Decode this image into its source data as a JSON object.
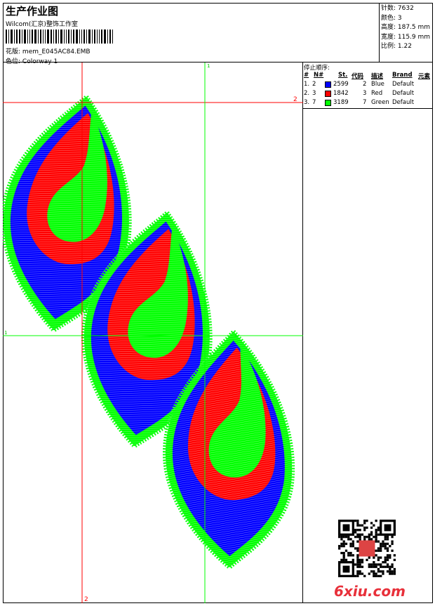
{
  "header": {
    "title": "生产作业图",
    "company": "Wilcom(汇京)整饰工作室",
    "design_label": "花版:",
    "design_value": "mem_E045AC84.EMB",
    "colorway_label": "色位:",
    "colorway_value": "Colorway 1"
  },
  "info": {
    "stitches": "针数: 7632",
    "colors": "颜色: 3",
    "height": "高度: 187.5 mm",
    "width": "宽度: 115.9 mm",
    "scale": "比例: 1.22"
  },
  "stop_sequence": {
    "title": "停止顺序:",
    "columns": [
      "#",
      "N#",
      "St.",
      "代码",
      "描述",
      "Brand",
      "元素"
    ],
    "rows": [
      {
        "idx": "1.",
        "n": "2",
        "color": "#0000ff",
        "st": "2599",
        "code": "2",
        "desc": "Blue",
        "brand": "Default"
      },
      {
        "idx": "2.",
        "n": "3",
        "color": "#ff0000",
        "st": "1842",
        "code": "3",
        "desc": "Red",
        "brand": "Default"
      },
      {
        "idx": "3.",
        "n": "7",
        "color": "#00ff00",
        "st": "3189",
        "code": "7",
        "desc": "Green",
        "brand": "Default"
      }
    ]
  },
  "guides": {
    "red_label": "2",
    "green_label": "1",
    "red_label_bottom": "2",
    "green_label_left": "1"
  },
  "watermark": "6xiu.com",
  "colors": {
    "blue": "#0000ff",
    "red": "#ff0000",
    "green": "#00ff00"
  }
}
